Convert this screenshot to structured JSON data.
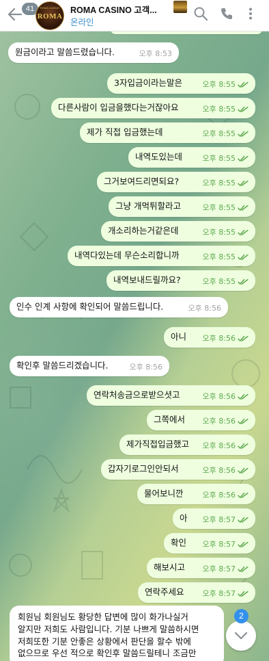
{
  "header": {
    "unread_count": "41",
    "avatar_text": "ROMA",
    "avatar_sub": "ROMA CASINO",
    "title": "ROMA CASINO 고객...",
    "status": "온라인"
  },
  "colors": {
    "incoming_bubble": "#ffffff",
    "outgoing_bubble": "#eefedf",
    "outgoing_meta": "#5ea94f",
    "incoming_meta": "#a2a2a2",
    "status_blue": "#3a8fd0",
    "badge_blue": "#3390ec"
  },
  "messages": [
    {
      "dir": "in",
      "text": "원금이라고 말씀드렸습니다.",
      "time": "오후 8:53"
    },
    {
      "dir": "out",
      "text": "3자입금이라는말은",
      "time": "오후 8:55"
    },
    {
      "dir": "out",
      "text": "다른사람이 입금을했다는거잖아요",
      "time": "오후 8:55"
    },
    {
      "dir": "out",
      "text": "제가 직접 입금했는데",
      "time": "오후 8:55"
    },
    {
      "dir": "out",
      "text": "내역도있는데",
      "time": "오후 8:55"
    },
    {
      "dir": "out",
      "text": "그거보여드리면되요?",
      "time": "오후 8:55"
    },
    {
      "dir": "out",
      "text": "그냥 개먹튀할라고",
      "time": "오후 8:55"
    },
    {
      "dir": "out",
      "text": "개소리하는거같은데",
      "time": "오후 8:55"
    },
    {
      "dir": "out",
      "text": "내역다있는데 무슨소리합니까",
      "time": "오후 8:55"
    },
    {
      "dir": "out",
      "text": "내역보내드릴까요?",
      "time": "오후 8:55"
    },
    {
      "dir": "in",
      "text": "인수 인계 사항에 확인되어 말씀드립니다.",
      "time": "오후 8:56"
    },
    {
      "dir": "out",
      "text": "아니",
      "time": "오후 8:56"
    },
    {
      "dir": "in",
      "text": "확인후 말씀드리겠습니다.",
      "time": "오후 8:56"
    },
    {
      "dir": "out",
      "text": "연락처송금으로받으셧고",
      "time": "오후 8:56"
    },
    {
      "dir": "out",
      "text": "그쪽에서",
      "time": "오후 8:56"
    },
    {
      "dir": "out",
      "text": "제가직접입금했고",
      "time": "오후 8:56"
    },
    {
      "dir": "out",
      "text": "갑자기로그인안되서",
      "time": "오후 8:56"
    },
    {
      "dir": "out",
      "text": "물어보니깐",
      "time": "오후 8:56"
    },
    {
      "dir": "out",
      "text": "아",
      "time": "오후 8:57"
    },
    {
      "dir": "out",
      "text": "확인",
      "time": "오후 8:57"
    },
    {
      "dir": "out",
      "text": "해보시고",
      "time": "오후 8:57"
    },
    {
      "dir": "out",
      "text": "연락주세요",
      "time": "오후 8:57"
    }
  ],
  "last_message": {
    "dir": "in",
    "lines": [
      "회원님 회원님도 황당한 답변에 많이 화가나실거",
      "알지만 저희도 사람입니다. 기분 나쁘게 말씀하시면",
      "저희또한 기분 안좋은 상황에서 판단을 할수 밖에",
      "없으므로 우선 적으로 확인후 말씀드릴테니 조금만"
    ]
  },
  "scroll_badge": "2"
}
